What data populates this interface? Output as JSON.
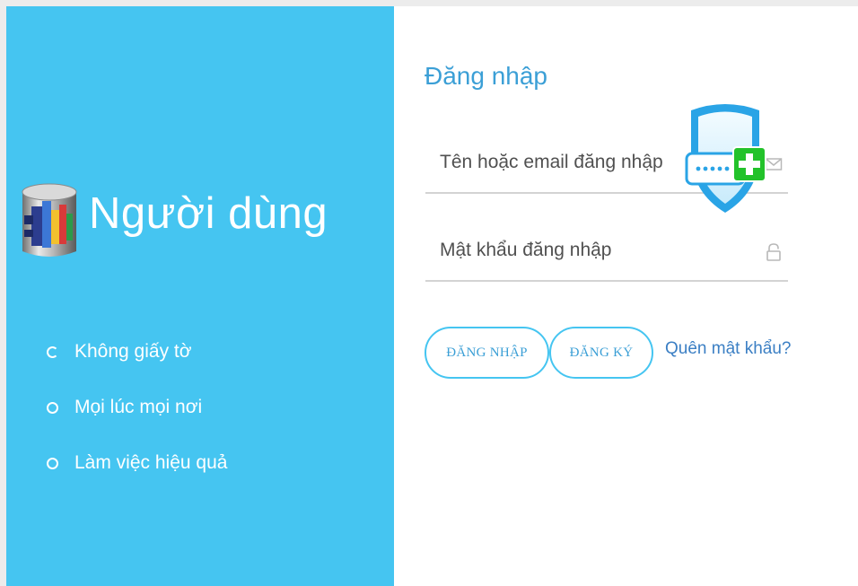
{
  "left_panel": {
    "brand_title": "Người dùng",
    "features": [
      {
        "label": "Không giấy tờ",
        "active": true
      },
      {
        "label": "Mọi lúc mọi nơi",
        "active": false
      },
      {
        "label": "Làm việc hiệu quả",
        "active": false
      }
    ]
  },
  "login": {
    "title": "Đăng nhập",
    "username_placeholder": "Tên hoặc email đăng nhập",
    "username_value": "",
    "password_placeholder": "Mật khẩu đăng nhập",
    "password_value": "",
    "login_button": "ĐĂNG NHẬP",
    "register_button": "ĐĂNG KÝ",
    "forgot_link": "Quên mật khẩu?"
  },
  "icons": {
    "brand": "database-logo-icon",
    "username_field": "envelope-icon",
    "password_field": "lock-icon",
    "overlay": "shield-password-add-icon"
  },
  "colors": {
    "panel": "#45c5f1",
    "accent_text": "#3b9fd6",
    "link": "#3b7fc4",
    "field_underline": "#d3d3d3",
    "shield_add": "#22c22a"
  }
}
